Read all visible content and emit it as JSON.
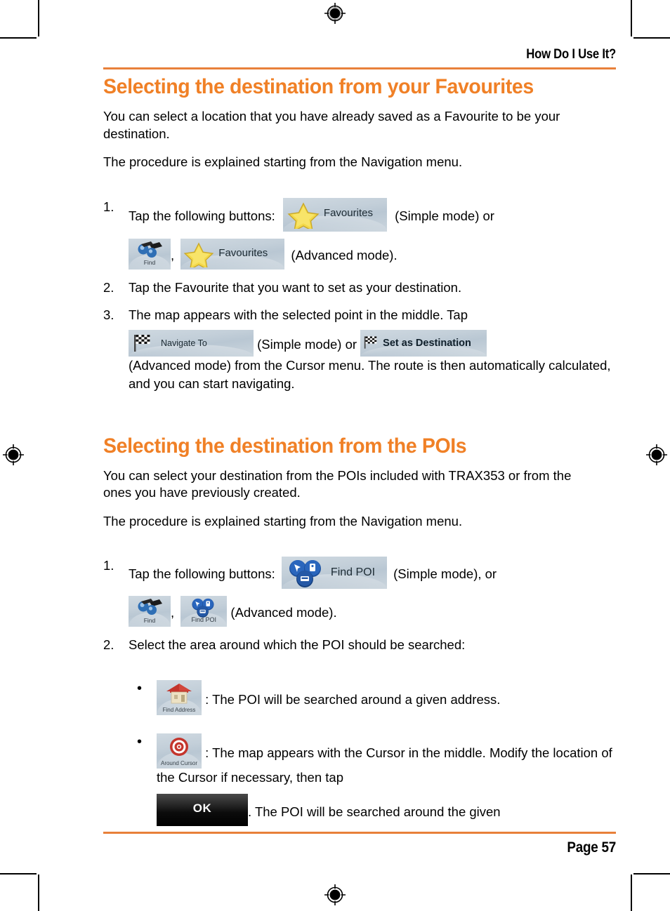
{
  "running_head": "How Do I Use It?",
  "page_number": "Page 57",
  "accent_color": "#F08026",
  "rule_color": "#E8803A",
  "sections": [
    {
      "heading": "Selecting the destination from your Favourites",
      "intro_1": "You can select a location that you have already saved as a Favourite to be your destination.",
      "intro_2": "The procedure is explained starting from the Navigation menu.",
      "steps": [
        {
          "number": "1.",
          "text_before": "Tap the following buttons:",
          "text_mid": "(Simple mode) or",
          "text_comma": ",",
          "text_after": "(Advanced mode)."
        },
        {
          "number": "2.",
          "text": "Tap the Favourite that you want to set as your destination."
        },
        {
          "number": "3.",
          "text_before": "The map appears with the selected point in the middle. Tap",
          "text_mid": "(Simple mode) or",
          "text_after": "(Advanced mode) from the Cursor menu. The route is then automatically calculated, and you can start navigating."
        }
      ]
    },
    {
      "heading": "Selecting the destination from the POIs",
      "intro_1": "You can select your destination from the POIs included with TRAX353 or from the ones you have previously created.",
      "intro_2": "The procedure is explained starting from the Navigation menu.",
      "steps": [
        {
          "number": "1.",
          "text_before": "Tap the following buttons:",
          "text_mid": "(Simple mode), or",
          "text_comma": ",",
          "text_after": "(Advanced mode)."
        },
        {
          "number": "2.",
          "text": "Select the area around which the POI should be searched:"
        }
      ],
      "bullets": [
        {
          "marker": "•",
          "text": ": The POI will be searched around a given address."
        },
        {
          "marker": "•",
          "text_before": ": The map appears with the Cursor in the middle. Modify the location of the Cursor if necessary, then tap",
          "text_after": ". The POI will be searched around the given"
        }
      ]
    }
  ],
  "buttons": {
    "favourites": "Favourites",
    "find": "Find",
    "navigate_to": "Navigate To",
    "set_as_destination": "Set as Destination",
    "find_poi": "Find POI",
    "find_poi_small": "Find POI",
    "find_address": "Find Address",
    "around_cursor": "Around Cursor",
    "ok": "OK"
  },
  "icons": {
    "star": "star-icon",
    "binoculars": "binoculars-icon",
    "checkered_flag": "checkered-flag-icon",
    "poi_group": "poi-group-icon",
    "house": "house-icon",
    "bullseye": "bullseye-target-icon",
    "registration": "registration-mark"
  }
}
